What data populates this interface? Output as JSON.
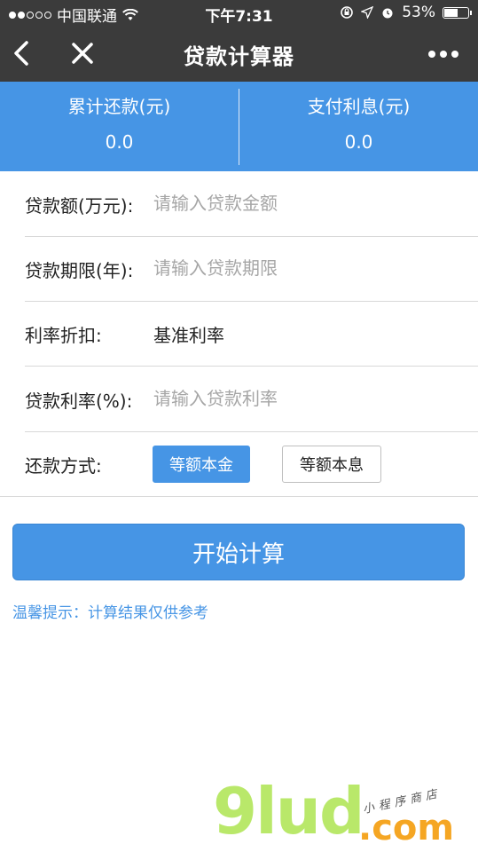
{
  "status_bar": {
    "carrier": "中国联通",
    "time": "下午7:31",
    "battery_percent_text": "53%",
    "battery_level": 0.53
  },
  "nav": {
    "title": "贷款计算器"
  },
  "summary": {
    "total_repayment_label": "累计还款(元)",
    "total_repayment_value": "0.0",
    "interest_label": "支付利息(元)",
    "interest_value": "0.0"
  },
  "form": {
    "amount_label": "贷款额(万元):",
    "amount_placeholder": "请输入贷款金额",
    "term_label": "贷款期限(年):",
    "term_placeholder": "请输入贷款期限",
    "discount_label": "利率折扣:",
    "discount_value": "基准利率",
    "rate_label": "贷款利率(%):",
    "rate_placeholder": "请输入贷款利率",
    "method_label": "还款方式:",
    "method_options": [
      "等额本金",
      "等额本息"
    ],
    "method_selected": "等额本金"
  },
  "actions": {
    "start_label": "开始计算"
  },
  "tip": "温馨提示：计算结果仅供参考",
  "watermark": {
    "brand": "9lud",
    "domain": ".com",
    "tagline": "小程序商店"
  },
  "colors": {
    "accent": "#4695e5",
    "nav_bg": "#3b3b3b",
    "separator": "#d8d8d8"
  }
}
